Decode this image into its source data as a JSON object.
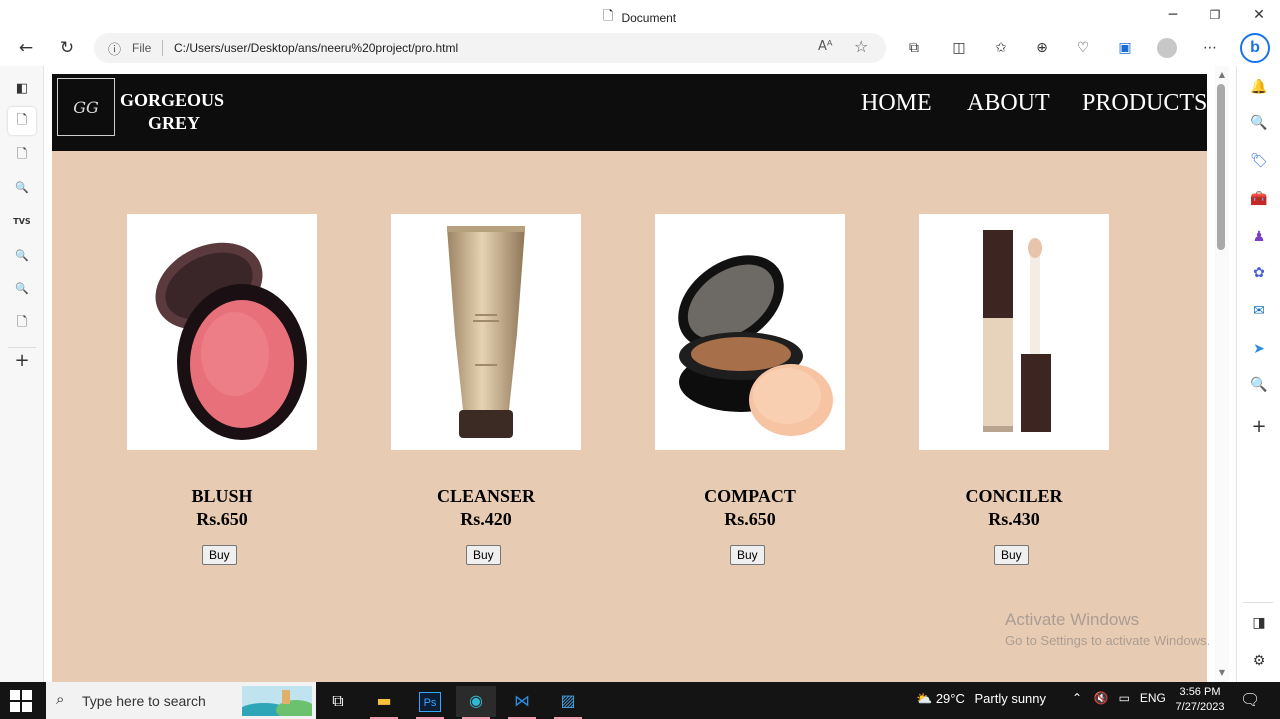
{
  "window": {
    "title": "Document"
  },
  "address": {
    "info_icon": "info-icon",
    "scheme_label": "File",
    "url": "C:/Users/user/Desktop/ans/neeru%20project/pro.html"
  },
  "site": {
    "brand_line1": "GORGEOUS",
    "brand_line2": "GREY",
    "logo_mark": "GG",
    "nav": [
      "HOME",
      "ABOUT",
      "PRODUCTS"
    ],
    "colors": {
      "header_bg": "#0d0d0d",
      "body_bg": "#e8cbb3"
    },
    "products": [
      {
        "name": "BLUSH",
        "price": "Rs.650",
        "button": "Buy"
      },
      {
        "name": "CLEANSER",
        "price": "Rs.420",
        "button": "Buy"
      },
      {
        "name": "COMPACT",
        "price": "Rs.650",
        "button": "Buy"
      },
      {
        "name": "CONCILER",
        "price": "Rs.430",
        "button": "Buy"
      }
    ]
  },
  "watermark": {
    "line1": "Activate Windows",
    "line2": "Go to Settings to activate Windows."
  },
  "taskbar": {
    "search_placeholder": "Type here to search",
    "weather_temp": "29°C",
    "weather_desc": "Partly sunny",
    "lang": "ENG",
    "time": "3:56 PM",
    "date": "7/27/2023"
  }
}
